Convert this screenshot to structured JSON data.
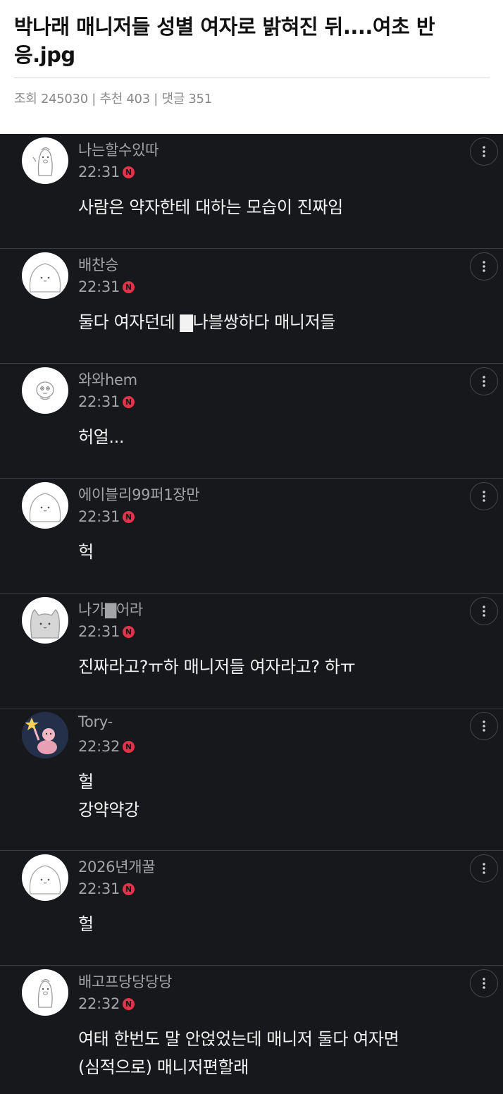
{
  "post": {
    "title": "박나래 매니저들 성별 여자로 밝혀진 뒤....여초 반응.jpg",
    "meta": "조회 245030 | 추천 403 | 댓글 351"
  },
  "badge_letter": "N",
  "colors": {
    "background": "#17181b",
    "badge": "#e0344a",
    "nickname": "#a3a4a8",
    "text": "#f2f2f2"
  },
  "comments": [
    {
      "nickname": "나는할수있따",
      "time": "22:31",
      "text": "사람은 약자한테 대하는 모습이 진짜임",
      "avatar": "penguin-avatar"
    },
    {
      "nickname": "배찬승",
      "time": "22:31",
      "text": "둘다 여자던데 ▇나블쌍하다 매니저들",
      "avatar": "blob-avatar"
    },
    {
      "nickname": "와와hem",
      "time": "22:31",
      "text": "허얼...",
      "avatar": "character-avatar"
    },
    {
      "nickname": "에이블리99퍼1장만",
      "time": "22:31",
      "text": "헉",
      "avatar": "blob-avatar"
    },
    {
      "nickname": "나가▇어라",
      "time": "22:31",
      "text": "진짜라고?ㅠ하 매니저들 여자라고? 하ㅠ",
      "avatar": "cat-avatar"
    },
    {
      "nickname": "Tory-",
      "time": "22:32",
      "text": "헐\n강약약강",
      "avatar": "star-avatar"
    },
    {
      "nickname": "2026년개꿀",
      "time": "22:31",
      "text": "헐",
      "avatar": "blob-avatar"
    },
    {
      "nickname": "배고프당당당당",
      "time": "22:32",
      "text": "여태 한번도 말 안얹었는데 매니저 둘다 여자면\n(심적으로) 매니저편할래",
      "avatar": "penguin-avatar"
    }
  ]
}
